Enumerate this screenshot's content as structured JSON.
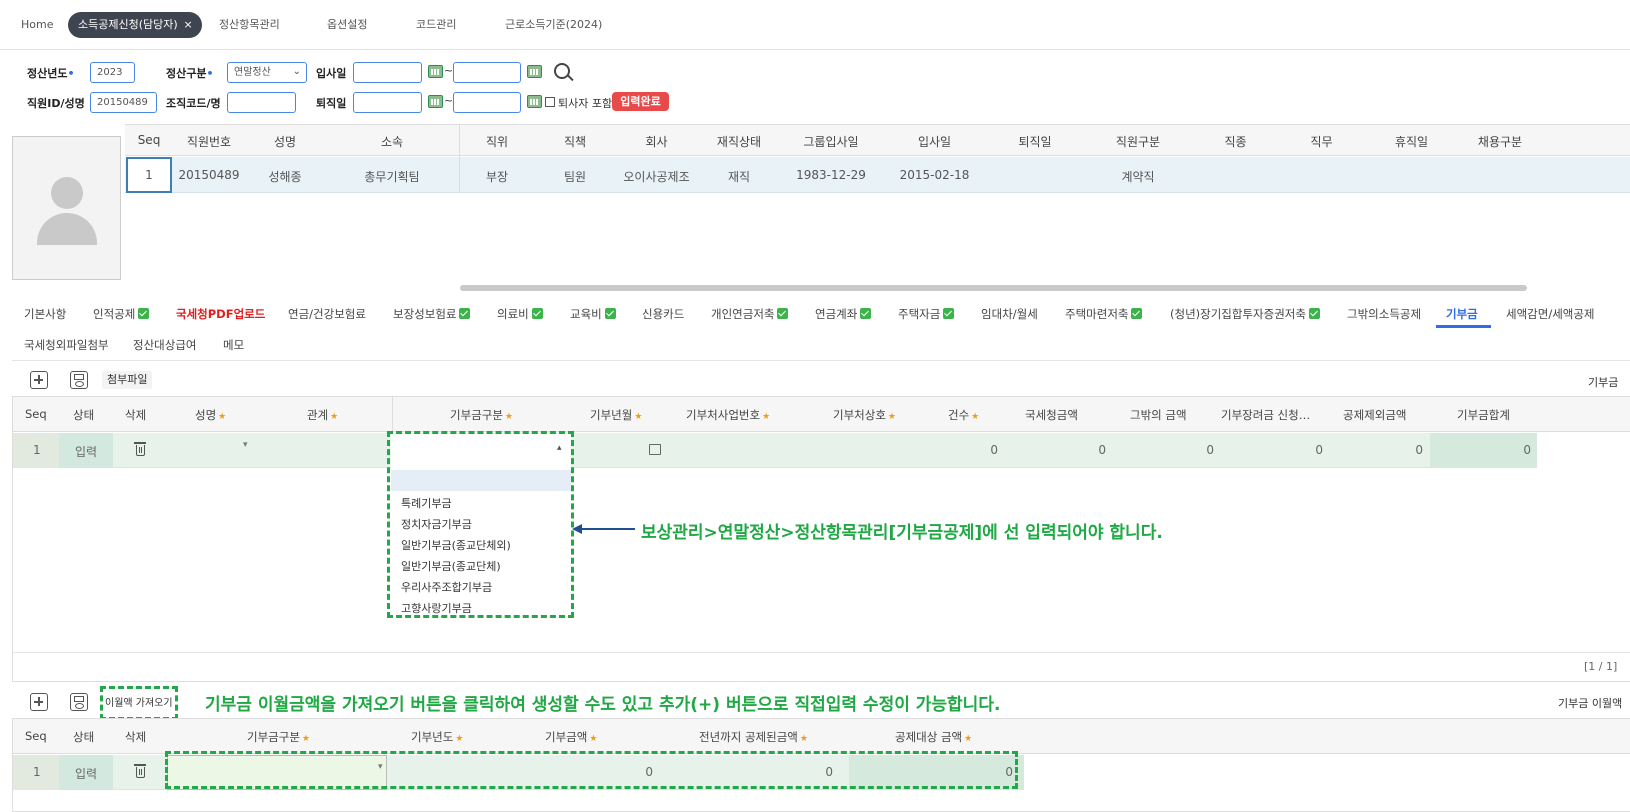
{
  "top_tabs": {
    "home": "Home",
    "active": "소득공제신청(담당자)",
    "close": "×",
    "items": [
      "정산항목관리",
      "옵션설정",
      "코드관리",
      "근로소득기준(2024)"
    ]
  },
  "search": {
    "year_label": "정산년도",
    "year_value": "2023",
    "type_label": "정산구분",
    "type_value": "연말정산",
    "join_label": "입사일",
    "emp_label": "직원ID/성명",
    "emp_value": "20150489",
    "org_label": "조직코드/명",
    "leave_label": "퇴직일",
    "tilde": "~",
    "retired_label": "퇴사자 포함",
    "status_badge": "입력완료"
  },
  "employee_grid": {
    "headers": [
      "Seq",
      "직원번호",
      "성명",
      "소속",
      "직위",
      "직책",
      "회사",
      "재직상태",
      "그룹입사일",
      "입사일",
      "퇴직일",
      "직원구분",
      "직종",
      "직무",
      "휴직일",
      "채용구분"
    ],
    "row": [
      "1",
      "20150489",
      "성해종",
      "총무기획팀",
      "부장",
      "팀원",
      "오이사공제조",
      "재직",
      "1983-12-29",
      "2015-02-18",
      "",
      "계약직",
      "",
      "",
      "",
      ""
    ]
  },
  "sub_tabs": [
    {
      "label": "기본사항",
      "check": false
    },
    {
      "label": "인적공제",
      "check": true
    },
    {
      "label": "국세청PDF업로드",
      "check": false,
      "red": true
    },
    {
      "label": "연금/건강보험료",
      "check": false
    },
    {
      "label": "보장성보험료",
      "check": true
    },
    {
      "label": "의료비",
      "check": true
    },
    {
      "label": "교육비",
      "check": true
    },
    {
      "label": "신용카드",
      "check": false
    },
    {
      "label": "개인연금저축",
      "check": true
    },
    {
      "label": "연금계좌",
      "check": true
    },
    {
      "label": "주택자금",
      "check": true
    },
    {
      "label": "임대차/월세",
      "check": false
    },
    {
      "label": "주택마련저축",
      "check": true
    },
    {
      "label": "(청년)장기집합투자증권저축",
      "check": true
    },
    {
      "label": "그밖의소득공제",
      "check": false
    },
    {
      "label": "기부금",
      "check": false,
      "active": true
    },
    {
      "label": "세액감면/세액공제",
      "check": false
    },
    {
      "label": "국세청외파일첨부",
      "check": false
    },
    {
      "label": "정산대상급여",
      "check": false
    },
    {
      "label": "메모",
      "check": false
    }
  ],
  "donation": {
    "attach_label": "첨부파일",
    "section_title": "기부금",
    "headers": [
      "Seq",
      "상태",
      "삭제",
      "성명",
      "관계",
      "기부금구분",
      "기부년월",
      "기부처사업번호",
      "기부처상호",
      "건수",
      "국세청금액",
      "그밖의 금액",
      "기부장려금 신청…",
      "공제제외금액",
      "기부금합계"
    ],
    "required": [
      false,
      false,
      false,
      true,
      true,
      true,
      true,
      true,
      true,
      true,
      false,
      false,
      false,
      false,
      false
    ],
    "row": {
      "seq": "1",
      "status": "입력",
      "count": "0",
      "nts": "0",
      "other": "0",
      "incentive": "0",
      "excluded": "0",
      "total": "0"
    },
    "dropdown_options": [
      "",
      "특례기부금",
      "정치자금기부금",
      "일반기부금(종교단체외)",
      "일반기부금(종교단체)",
      "우리사주조합기부금",
      "고향사랑기부금"
    ],
    "pager": "[1 / 1]"
  },
  "carryover": {
    "fetch_label": "이월액 가져오기",
    "section_title": "기부금 이월액",
    "headers": [
      "Seq",
      "상태",
      "삭제",
      "기부금구분",
      "기부년도",
      "기부금액",
      "전년까지 공제된금액",
      "공제대상 금액"
    ],
    "required": [
      false,
      false,
      false,
      true,
      true,
      true,
      true,
      true
    ],
    "row": {
      "seq": "1",
      "status": "입력",
      "amount": "0",
      "deducted": "0",
      "target": "0"
    }
  },
  "annotations": {
    "dropdown_note": "보상관리>연말정산>정산항목관리[기부금공제]에 선 입력되어야 합니다.",
    "carryover_note": "기부금 이월금액을 가져오기 버튼을 클릭하여 생성할 수도 있고 추가(+) 버튼으로 직접입력 수정이 가능합니다.",
    "color": "#1fa844"
  }
}
